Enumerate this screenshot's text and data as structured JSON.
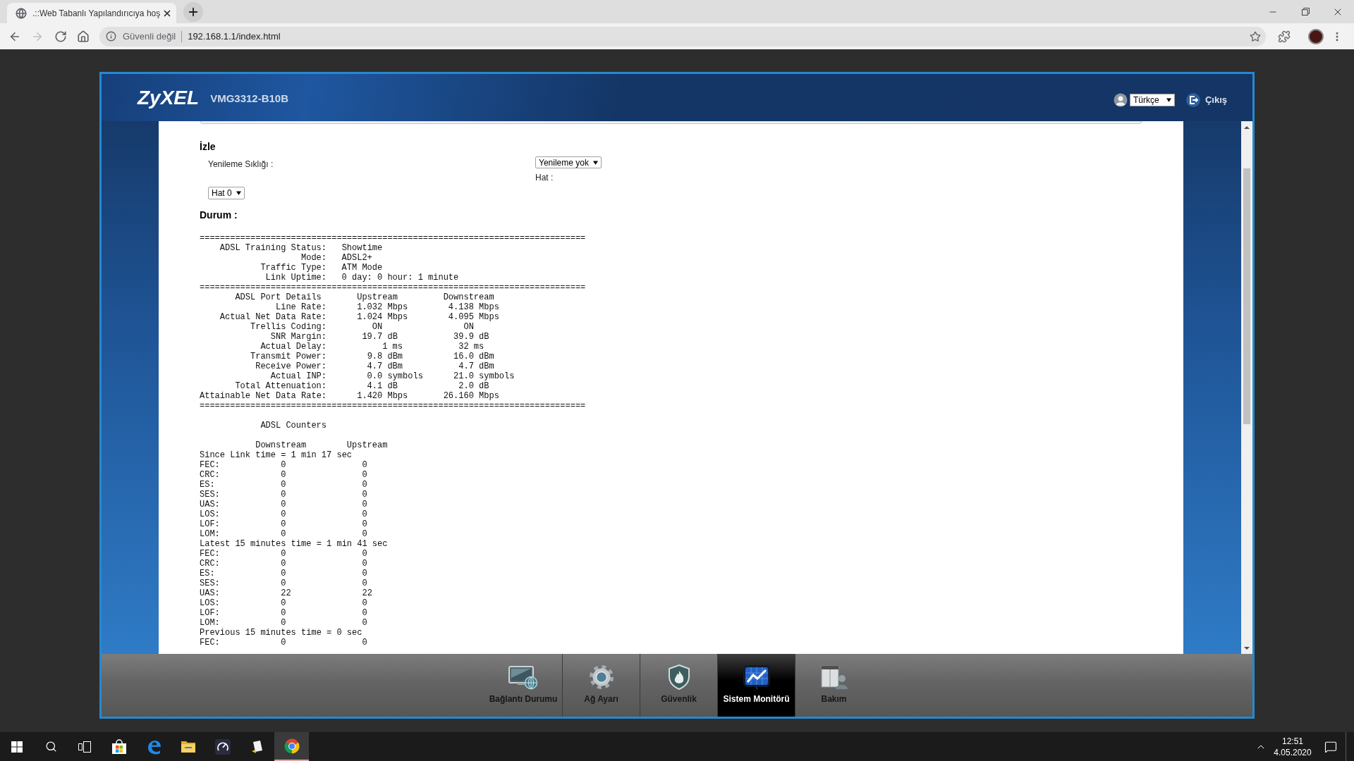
{
  "browser": {
    "tab": {
      "title": ".::Web Tabanlı Yapılandırıcıya hoş",
      "selected": true
    },
    "back": {
      "disabled": false
    },
    "forward": {
      "disabled": true
    },
    "address_bar": {
      "security_label": "Güvenli değil",
      "url": "192.168.1.1/index.html"
    }
  },
  "router": {
    "logo": "ZyXEL",
    "model": "VMG3312-B10B",
    "language_select": {
      "value": "Türkçe"
    },
    "logout": "Çıkış",
    "page": {
      "title": "İzle",
      "refresh": {
        "label": "Yenileme Sıklığı :",
        "value": "Yenileme yok"
      },
      "line": {
        "label": "Hat :",
        "value": "Hat 0"
      },
      "status_label": "Durum :",
      "report": [
        {
          "lines": [
            "============================================================================",
            "    ADSL Training Status:   Showtime",
            "                    Mode:   ADSL2+",
            "            Traffic Type:   ATM Mode",
            "             Link Uptime:   0 day: 0 hour: 1 minute",
            "============================================================================",
            "       ADSL Port Details       Upstream         Downstream",
            "               Line Rate:      1.032 Mbps        4.138 Mbps",
            "    Actual Net Data Rate:      1.024 Mbps        4.095 Mbps",
            "          Trellis Coding:         ON                ON",
            "              SNR Margin:       19.7 dB           39.9 dB",
            "            Actual Delay:           1 ms           32 ms",
            "          Transmit Power:        9.8 dBm          16.0 dBm",
            "           Receive Power:        4.7 dBm           4.7 dBm",
            "              Actual INP:        0.0 symbols      21.0 symbols",
            "       Total Attenuation:        4.1 dB            2.0 dB",
            "Attainable Net Data Rate:      1.420 Mbps       26.160 Mbps",
            "============================================================================"
          ]
        },
        {
          "lines": [
            "            ADSL Counters"
          ]
        },
        {
          "lines": [
            "           Downstream        Upstream",
            "Since Link time = 1 min 17 sec",
            "FEC:            0               0",
            "CRC:            0               0",
            "ES:             0               0",
            "SES:            0               0",
            "UAS:            0               0",
            "LOS:            0               0",
            "LOF:            0               0",
            "LOM:            0               0",
            "Latest 15 minutes time = 1 min 41 sec",
            "FEC:            0               0",
            "CRC:            0               0",
            "ES:             0               0",
            "SES:            0               0",
            "UAS:            22              22",
            "LOS:            0               0",
            "LOF:            0               0",
            "LOM:            0               0",
            "Previous 15 minutes time = 0 sec",
            "FEC:            0               0"
          ]
        }
      ]
    },
    "menu": [
      {
        "kind": "connection",
        "label": "Bağlantı Durumu",
        "selected": false
      },
      {
        "kind": "network",
        "label": "Ağ Ayarı",
        "selected": false
      },
      {
        "kind": "security",
        "label": "Güvenlik",
        "selected": false
      },
      {
        "kind": "monitor",
        "label": "Sistem Monitörü",
        "selected": true
      },
      {
        "kind": "maintenance",
        "label": "Bakım",
        "selected": false
      }
    ]
  },
  "taskbar": {
    "apps": [
      {
        "kind": "store",
        "selected": false
      },
      {
        "kind": "edge",
        "selected": false
      },
      {
        "kind": "explorer",
        "selected": false
      },
      {
        "kind": "gauge",
        "selected": false
      },
      {
        "kind": "notes",
        "selected": false
      },
      {
        "kind": "chrome",
        "selected": true
      }
    ],
    "time": "12:51",
    "date": "4.05.2020"
  }
}
